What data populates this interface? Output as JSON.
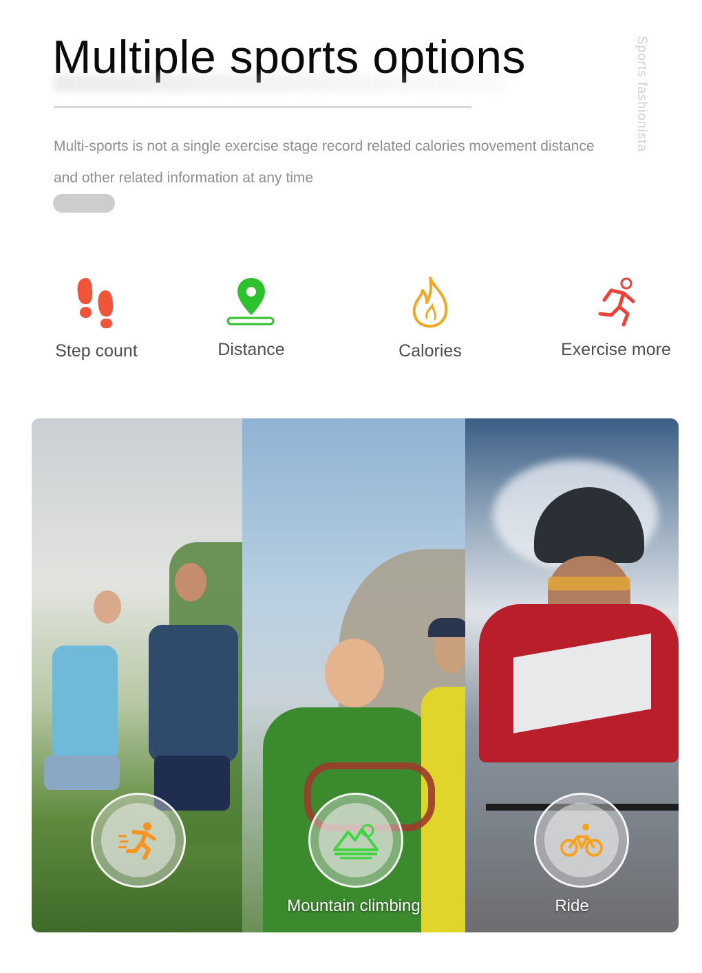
{
  "header": {
    "title": "Multiple sports options",
    "side_label": "Sports fashionista",
    "description": "Multi-sports is not a single exercise stage record related calories movement distance and other related information at any time"
  },
  "features": [
    {
      "label": "Step count",
      "icon": "footprints-icon",
      "color": "#f0553a"
    },
    {
      "label": "Distance",
      "icon": "location-pin-icon",
      "color": "#2ec12e"
    },
    {
      "label": "Calories",
      "icon": "flame-icon",
      "color": "#f5a623"
    },
    {
      "label": "Exercise more",
      "icon": "runner-icon",
      "color": "#ee4035"
    }
  ],
  "gallery": [
    {
      "label": "",
      "icon": "running-icon",
      "icon_color": "#f7931e",
      "scene": "couple jogging in park"
    },
    {
      "label": "Mountain climbing",
      "icon": "mountain-icon",
      "icon_color": "#3fd43f",
      "scene": "hikers with climbing rope"
    },
    {
      "label": "Ride",
      "icon": "bicycle-icon",
      "icon_color": "#f7a21e",
      "scene": "road cyclist with helmet"
    }
  ]
}
